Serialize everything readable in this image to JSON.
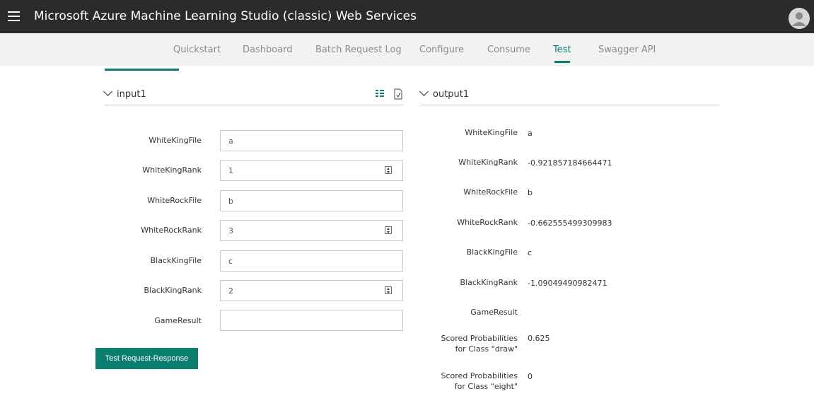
{
  "header": {
    "title": "Microsoft Azure Machine Learning Studio (classic) Web Services"
  },
  "nav": {
    "tabs": [
      {
        "label": "Quickstart"
      },
      {
        "label": "Dashboard"
      },
      {
        "label": "Batch Request Log"
      },
      {
        "label": "Configure"
      },
      {
        "label": "Consume"
      },
      {
        "label": "Test"
      },
      {
        "label": "Swagger API"
      }
    ],
    "active": "Test"
  },
  "input": {
    "title": "input1",
    "fields": [
      {
        "label": "WhiteKingFile",
        "value": "a"
      },
      {
        "label": "WhiteKingRank",
        "value": "1"
      },
      {
        "label": "WhiteRockFile",
        "value": "b"
      },
      {
        "label": "WhiteRockRank",
        "value": "3"
      },
      {
        "label": "BlackKingFile",
        "value": "c"
      },
      {
        "label": "BlackKingRank",
        "value": "2"
      },
      {
        "label": "GameResult",
        "value": ""
      }
    ],
    "button_label": "Test Request-Response"
  },
  "output": {
    "title": "output1",
    "rows": [
      {
        "label": "WhiteKingFile",
        "value": "a"
      },
      {
        "label": "WhiteKingRank",
        "value": "-0.921857184664471"
      },
      {
        "label": "WhiteRockFile",
        "value": "b"
      },
      {
        "label": "WhiteRockRank",
        "value": "-0.662555499309983"
      },
      {
        "label": "BlackKingFile",
        "value": "c"
      },
      {
        "label": "BlackKingRank",
        "value": "-1.09049490982471"
      },
      {
        "label": "GameResult",
        "value": ""
      },
      {
        "label_line1": "Scored Probabilities",
        "label_line2": "for Class \"draw\"",
        "value": "0.625"
      },
      {
        "label_line1": "Scored Probabilities",
        "label_line2": "for Class \"eight\"",
        "value": "0"
      }
    ]
  },
  "colors": {
    "accent": "#0a7d6d",
    "topbar": "#2b2b2b",
    "navbar": "#f2f2f2"
  },
  "icons": {
    "menu": "hamburger-icon",
    "user": "avatar-icon",
    "form_view": "list-view-icon",
    "csv": "csv-icon",
    "collapse": "chevron-down-icon",
    "stepper": "spin-stepper-icon"
  }
}
